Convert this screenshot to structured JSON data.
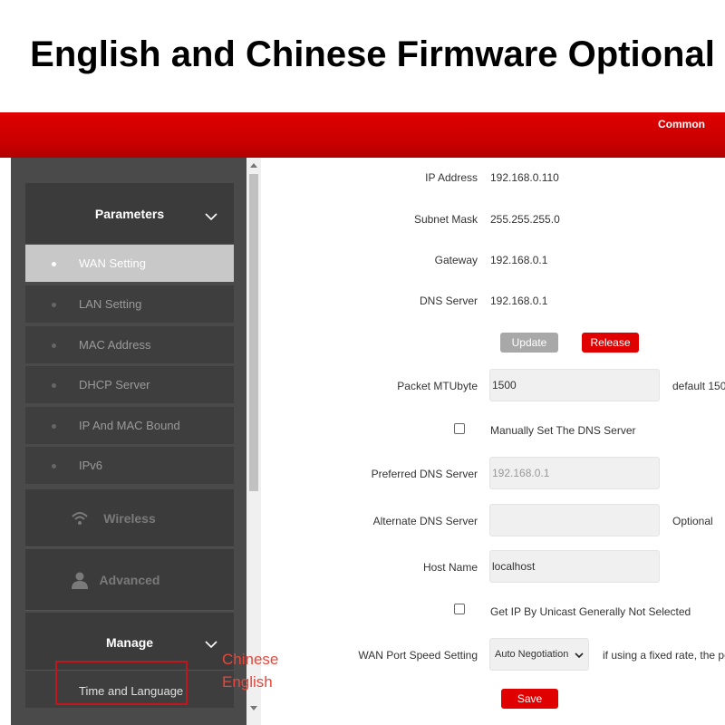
{
  "banner": {
    "title": "English and Chinese Firmware Optional"
  },
  "topbar": {
    "common_label": "Common",
    "color": "#d00000"
  },
  "sidebar": {
    "parameters": {
      "label": "Parameters",
      "icon": "chevron-down-icon",
      "items": [
        {
          "label": "WAN Setting",
          "active": true
        },
        {
          "label": "LAN Setting"
        },
        {
          "label": "MAC Address"
        },
        {
          "label": "DHCP Server"
        },
        {
          "label": "IP And MAC Bound"
        },
        {
          "label": "IPv6"
        }
      ]
    },
    "wireless": {
      "label": "Wireless",
      "icon": "wifi-icon"
    },
    "advanced": {
      "label": "Advanced",
      "icon": "person-icon"
    },
    "manage": {
      "label": "Manage",
      "icon": "chevron-down-icon",
      "items": [
        {
          "label": "Time and Language"
        }
      ]
    }
  },
  "form": {
    "ip_address": {
      "label": "IP Address",
      "value": "192.168.0.110"
    },
    "subnet_mask": {
      "label": "Subnet Mask",
      "value": "255.255.255.0"
    },
    "gateway": {
      "label": "Gateway",
      "value": "192.168.0.1"
    },
    "dns_server": {
      "label": "DNS Server",
      "value": "192.168.0.1"
    },
    "update_button": "Update",
    "release_button": "Release",
    "packet_mtu": {
      "label": "Packet MTUbyte",
      "value": "1500",
      "hint": "default 150"
    },
    "manual_dns": {
      "label": "Manually Set The DNS Server",
      "checked": false
    },
    "preferred_dns": {
      "label": "Preferred DNS Server",
      "placeholder": "192.168.0.1"
    },
    "alternate_dns": {
      "label": "Alternate DNS Server",
      "value": "",
      "hint": "Optional"
    },
    "host_name": {
      "label": "Host Name",
      "value": "localhost"
    },
    "unicast": {
      "label": "Get IP By Unicast Generally Not Selected",
      "checked": false
    },
    "wan_speed": {
      "label": "WAN Port Speed Setting",
      "selected": "Auto Negotiation",
      "hint": "if using a fixed rate, the pe"
    },
    "save_button": "Save"
  },
  "annotation": {
    "line1": "Chinese",
    "line2": "English",
    "color": "#e8473c"
  }
}
